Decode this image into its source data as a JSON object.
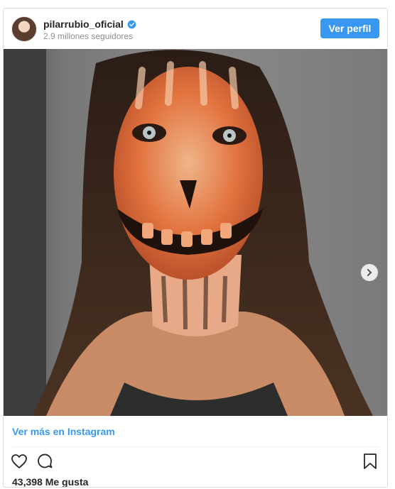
{
  "post": {
    "username": "pilarrubio_oficial",
    "followers": "2.9 millones seguidores",
    "profile_button": "Ver perfil",
    "more_link": "Ver más en Instagram",
    "likes": "43,398 Me gusta"
  },
  "icons": {
    "verified": "verified-badge-icon",
    "next": "chevron-right-icon",
    "like": "heart-icon",
    "comment": "comment-icon",
    "save": "bookmark-icon"
  },
  "colors": {
    "accent": "#3897f0",
    "text": "#262626",
    "muted": "#8e8e8e"
  }
}
